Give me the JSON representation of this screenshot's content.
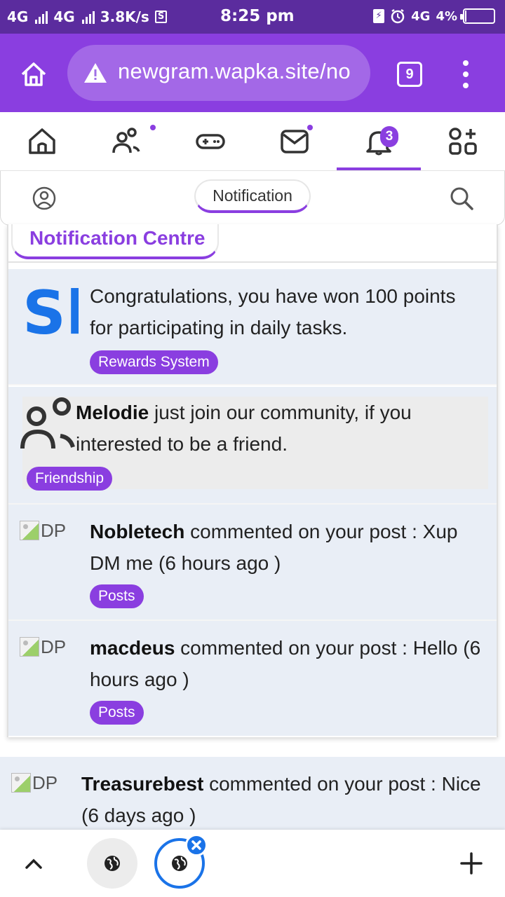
{
  "status_bar": {
    "network1": "4G",
    "network2": "4G",
    "speed": "3.8K/s",
    "time": "8:25 pm",
    "network3": "4G",
    "battery_text": "4%",
    "battery_level": 0.04
  },
  "browser": {
    "url": "newgram.wapka.site/no",
    "tab_count": "9",
    "accent": "#8a3ee0"
  },
  "app_nav": {
    "items": [
      {
        "icon": "home-icon"
      },
      {
        "icon": "people-icon",
        "dot": true
      },
      {
        "icon": "gamepad-icon"
      },
      {
        "icon": "mail-icon",
        "dot": true
      },
      {
        "icon": "bell-icon",
        "badge": "3",
        "active": true
      },
      {
        "icon": "apps-icon"
      }
    ]
  },
  "sub_header": {
    "title": "Notification"
  },
  "card": {
    "title": "Notification Centre"
  },
  "notifications": [
    {
      "avatar": "Sb",
      "text": "Congratulations, you have won 100 points for participating in daily tasks.",
      "tag": "Rewards System"
    },
    {
      "user": "Melodie",
      "text": " just join our community, if you interested to be a friend.",
      "tag": "Friendship"
    },
    {
      "dp_alt": "DP",
      "user": "Nobletech",
      "text": " commented on your post : Xup DM me (6 hours ago )",
      "tag": "Posts"
    },
    {
      "dp_alt": "DP",
      "user": "macdeus",
      "text": " commented on your post : Hello (6 hours ago )",
      "tag": "Posts"
    }
  ],
  "bottom_notification": {
    "dp_alt": "DP",
    "user": "Treasurebest",
    "text": " commented on your post : Nice (6 days ago )"
  }
}
